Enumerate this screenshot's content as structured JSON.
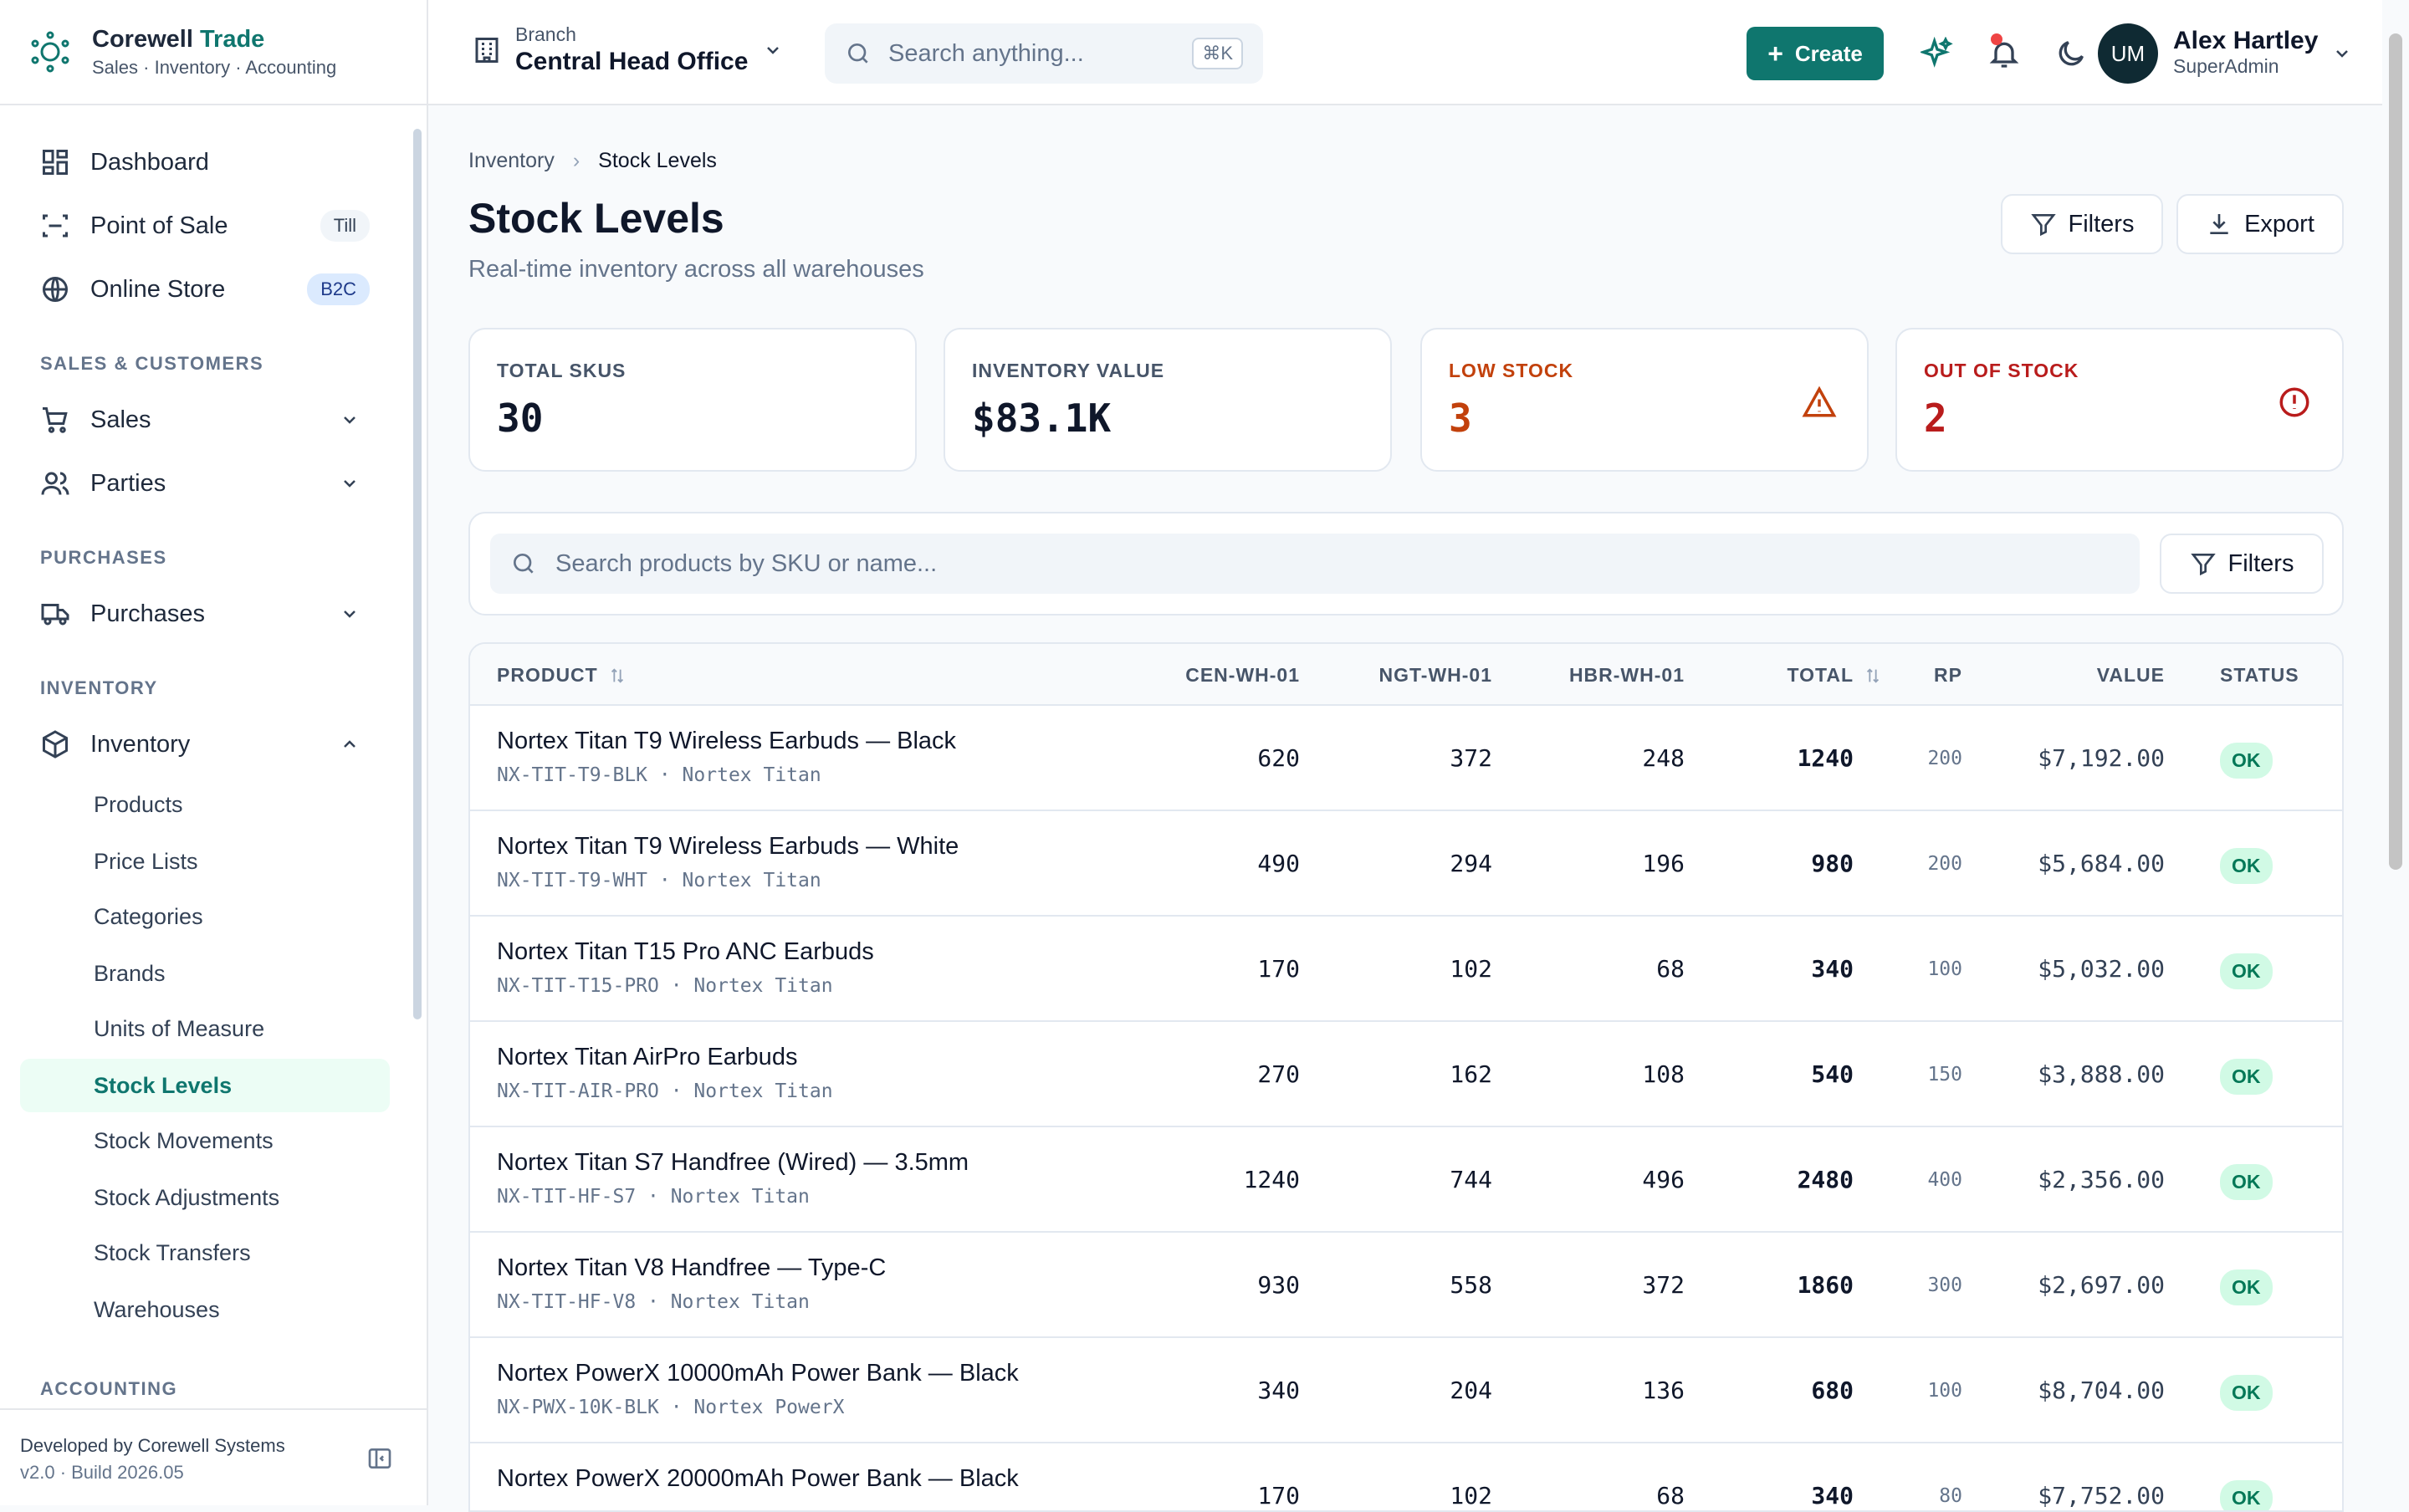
{
  "brand": {
    "name_main": "Corewell",
    "name_accent": "Trade",
    "tagline": "Sales · Inventory · Accounting"
  },
  "sidebar": {
    "top_items": [
      {
        "label": "Dashboard",
        "icon": "dashboard-icon"
      },
      {
        "label": "Point of Sale",
        "icon": "scan-icon",
        "badge": "Till"
      },
      {
        "label": "Online Store",
        "icon": "globe-icon",
        "badge": "B2C"
      }
    ],
    "sections": {
      "sales_customers": "SALES & CUSTOMERS",
      "purchases": "PURCHASES",
      "inventory": "INVENTORY",
      "accounting": "ACCOUNTING"
    },
    "sales": "Sales",
    "parties": "Parties",
    "purchases_item": "Purchases",
    "inventory_item": "Inventory",
    "inventory_sub": [
      "Products",
      "Price Lists",
      "Categories",
      "Brands",
      "Units of Measure",
      "Stock Levels",
      "Stock Movements",
      "Stock Adjustments",
      "Stock Transfers",
      "Warehouses"
    ],
    "active_sub": "Stock Levels",
    "footer": {
      "developer": "Developed by Corewell Systems",
      "version": "v2.0 · Build 2026.05"
    }
  },
  "topbar": {
    "branch_label": "Branch",
    "branch_name": "Central Head Office",
    "search_placeholder": "Search anything...",
    "search_shortcut": "⌘K",
    "create_label": "Create",
    "user_initials": "UM",
    "user_name": "Alex Hartley",
    "user_role": "SuperAdmin"
  },
  "page": {
    "breadcrumb": [
      "Inventory",
      "Stock Levels"
    ],
    "title": "Stock Levels",
    "subtitle": "Real-time inventory across all warehouses",
    "filters_label": "Filters",
    "export_label": "Export"
  },
  "stats": [
    {
      "label": "TOTAL SKUS",
      "value": "30",
      "color": "#0f172a"
    },
    {
      "label": "INVENTORY VALUE",
      "value": "$83.1K",
      "color": "#0f172a"
    },
    {
      "label": "LOW STOCK",
      "value": "3",
      "color": "#c2410c"
    },
    {
      "label": "OUT OF STOCK",
      "value": "2",
      "color": "#b91c1c"
    }
  ],
  "table_search_placeholder": "Search products by SKU or name...",
  "table_filters_label": "Filters",
  "table": {
    "columns": [
      "PRODUCT",
      "CEN-WH-01",
      "NGT-WH-01",
      "HBR-WH-01",
      "TOTAL",
      "RP",
      "VALUE",
      "STATUS"
    ],
    "rows": [
      {
        "name": "Nortex Titan T9 Wireless Earbuds — Black",
        "sku": "NX-TIT-T9-BLK · Nortex Titan",
        "cen": "620",
        "ngt": "372",
        "hbr": "248",
        "total": "1240",
        "rp": "200",
        "value": "$7,192.00",
        "status": "OK"
      },
      {
        "name": "Nortex Titan T9 Wireless Earbuds — White",
        "sku": "NX-TIT-T9-WHT · Nortex Titan",
        "cen": "490",
        "ngt": "294",
        "hbr": "196",
        "total": "980",
        "rp": "200",
        "value": "$5,684.00",
        "status": "OK"
      },
      {
        "name": "Nortex Titan T15 Pro ANC Earbuds",
        "sku": "NX-TIT-T15-PRO · Nortex Titan",
        "cen": "170",
        "ngt": "102",
        "hbr": "68",
        "total": "340",
        "rp": "100",
        "value": "$5,032.00",
        "status": "OK"
      },
      {
        "name": "Nortex Titan AirPro Earbuds",
        "sku": "NX-TIT-AIR-PRO · Nortex Titan",
        "cen": "270",
        "ngt": "162",
        "hbr": "108",
        "total": "540",
        "rp": "150",
        "value": "$3,888.00",
        "status": "OK"
      },
      {
        "name": "Nortex Titan S7 Handfree (Wired) — 3.5mm",
        "sku": "NX-TIT-HF-S7 · Nortex Titan",
        "cen": "1240",
        "ngt": "744",
        "hbr": "496",
        "total": "2480",
        "rp": "400",
        "value": "$2,356.00",
        "status": "OK"
      },
      {
        "name": "Nortex Titan V8 Handfree — Type-C",
        "sku": "NX-TIT-HF-V8 · Nortex Titan",
        "cen": "930",
        "ngt": "558",
        "hbr": "372",
        "total": "1860",
        "rp": "300",
        "value": "$2,697.00",
        "status": "OK"
      },
      {
        "name": "Nortex PowerX 10000mAh Power Bank — Black",
        "sku": "NX-PWX-10K-BLK · Nortex PowerX",
        "cen": "340",
        "ngt": "204",
        "hbr": "136",
        "total": "680",
        "rp": "100",
        "value": "$8,704.00",
        "status": "OK"
      },
      {
        "name": "Nortex PowerX 20000mAh Power Bank — Black",
        "sku": "",
        "cen": "170",
        "ngt": "102",
        "hbr": "68",
        "total": "340",
        "rp": "80",
        "value": "$7,752.00",
        "status": "OK"
      }
    ]
  },
  "colors": {
    "accent": "#0f766e",
    "ok_bg": "#d1fae5",
    "ok_text": "#047857",
    "warn": "#c2410c",
    "danger": "#b91c1c"
  }
}
